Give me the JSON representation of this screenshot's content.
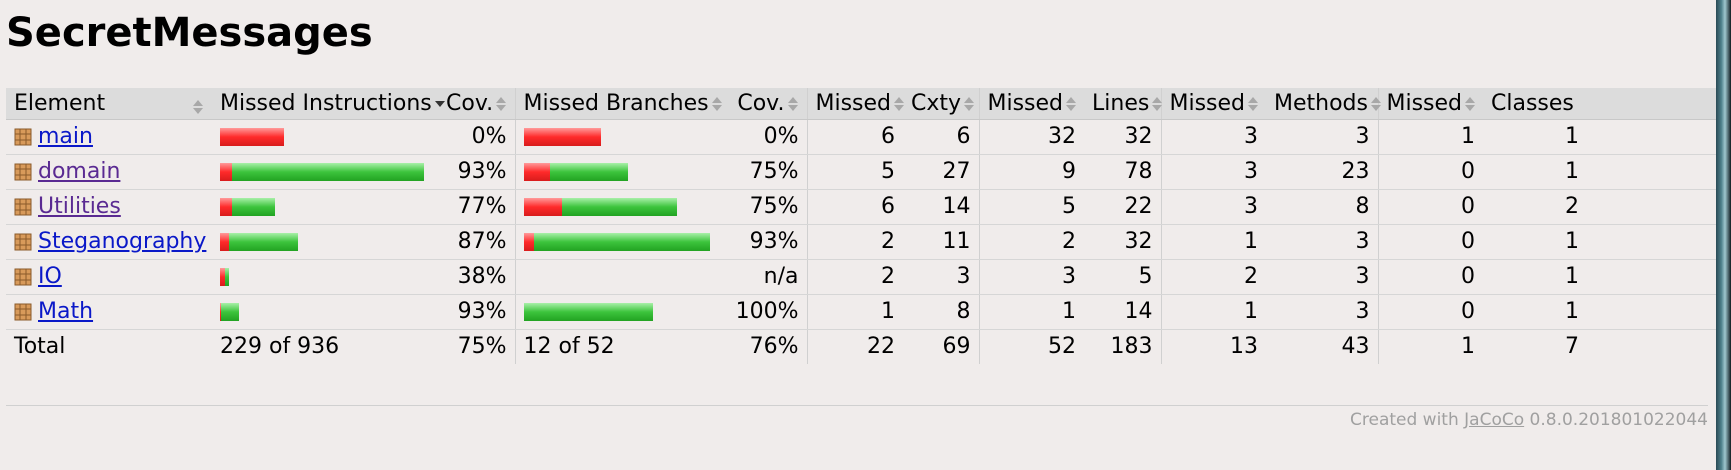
{
  "title": "SecretMessages",
  "headers": {
    "element": "Element",
    "missed_instructions": "Missed Instructions",
    "cov1": "Cov.",
    "missed_branches": "Missed Branches",
    "cov2": "Cov.",
    "missed_cxty": "Missed",
    "cxty": "Cxty",
    "missed_lines": "Missed",
    "lines": "Lines",
    "missed_methods": "Missed",
    "methods": "Methods",
    "missed_classes": "Missed",
    "classes": "Classes"
  },
  "rows": [
    {
      "name": "main",
      "visited": false,
      "instr_cov": "0%",
      "branch_cov": "0%",
      "missed_cxty": "6",
      "cxty": "6",
      "missed_lines": "32",
      "lines": "32",
      "missed_methods": "3",
      "methods": "3",
      "missed_classes": "1",
      "classes": "1",
      "instr_bar": {
        "red": 64,
        "green": 0
      },
      "branch_bar": {
        "red": 77,
        "green": 0
      }
    },
    {
      "name": "domain",
      "visited": true,
      "instr_cov": "93%",
      "branch_cov": "75%",
      "missed_cxty": "5",
      "cxty": "27",
      "missed_lines": "9",
      "lines": "78",
      "missed_methods": "3",
      "methods": "23",
      "missed_classes": "0",
      "classes": "1",
      "instr_bar": {
        "red": 12,
        "green": 192
      },
      "branch_bar": {
        "red": 26,
        "green": 78
      }
    },
    {
      "name": "Utilities",
      "visited": true,
      "instr_cov": "77%",
      "branch_cov": "75%",
      "missed_cxty": "6",
      "cxty": "14",
      "missed_lines": "5",
      "lines": "22",
      "missed_methods": "3",
      "methods": "8",
      "missed_classes": "0",
      "classes": "2",
      "instr_bar": {
        "red": 12,
        "green": 43
      },
      "branch_bar": {
        "red": 38,
        "green": 115
      }
    },
    {
      "name": "Steganography",
      "visited": false,
      "instr_cov": "87%",
      "branch_cov": "93%",
      "missed_cxty": "2",
      "cxty": "11",
      "missed_lines": "2",
      "lines": "32",
      "missed_methods": "1",
      "methods": "3",
      "missed_classes": "0",
      "classes": "1",
      "instr_bar": {
        "red": 9,
        "green": 69
      },
      "branch_bar": {
        "red": 12,
        "green": 192
      }
    },
    {
      "name": "IO",
      "visited": false,
      "instr_cov": "38%",
      "branch_cov": "n/a",
      "missed_cxty": "2",
      "cxty": "3",
      "missed_lines": "3",
      "lines": "5",
      "missed_methods": "2",
      "methods": "3",
      "missed_classes": "0",
      "classes": "1",
      "instr_bar": {
        "red": 5,
        "green": 4
      },
      "branch_bar": null
    },
    {
      "name": "Math",
      "visited": false,
      "instr_cov": "93%",
      "branch_cov": "100%",
      "missed_cxty": "1",
      "cxty": "8",
      "missed_lines": "1",
      "lines": "14",
      "missed_methods": "1",
      "methods": "3",
      "missed_classes": "0",
      "classes": "1",
      "instr_bar": {
        "red": 1,
        "green": 18
      },
      "branch_bar": {
        "red": 0,
        "green": 129
      }
    }
  ],
  "total": {
    "label": "Total",
    "missed_instructions": "229 of 936",
    "instr_cov": "75%",
    "missed_branches": "12 of 52",
    "branch_cov": "76%",
    "missed_cxty": "22",
    "cxty": "69",
    "missed_lines": "52",
    "lines": "183",
    "missed_methods": "13",
    "methods": "43",
    "missed_classes": "1",
    "classes": "7"
  },
  "footer": {
    "prefix": "Created with ",
    "link": "JaCoCo",
    "suffix": " 0.8.0.201801022044"
  },
  "colors": {
    "missed_bar": "#ff2a2a",
    "covered_bar": "#3cc43c",
    "link": "#0a18c8",
    "visited_link": "#5a2a92"
  }
}
